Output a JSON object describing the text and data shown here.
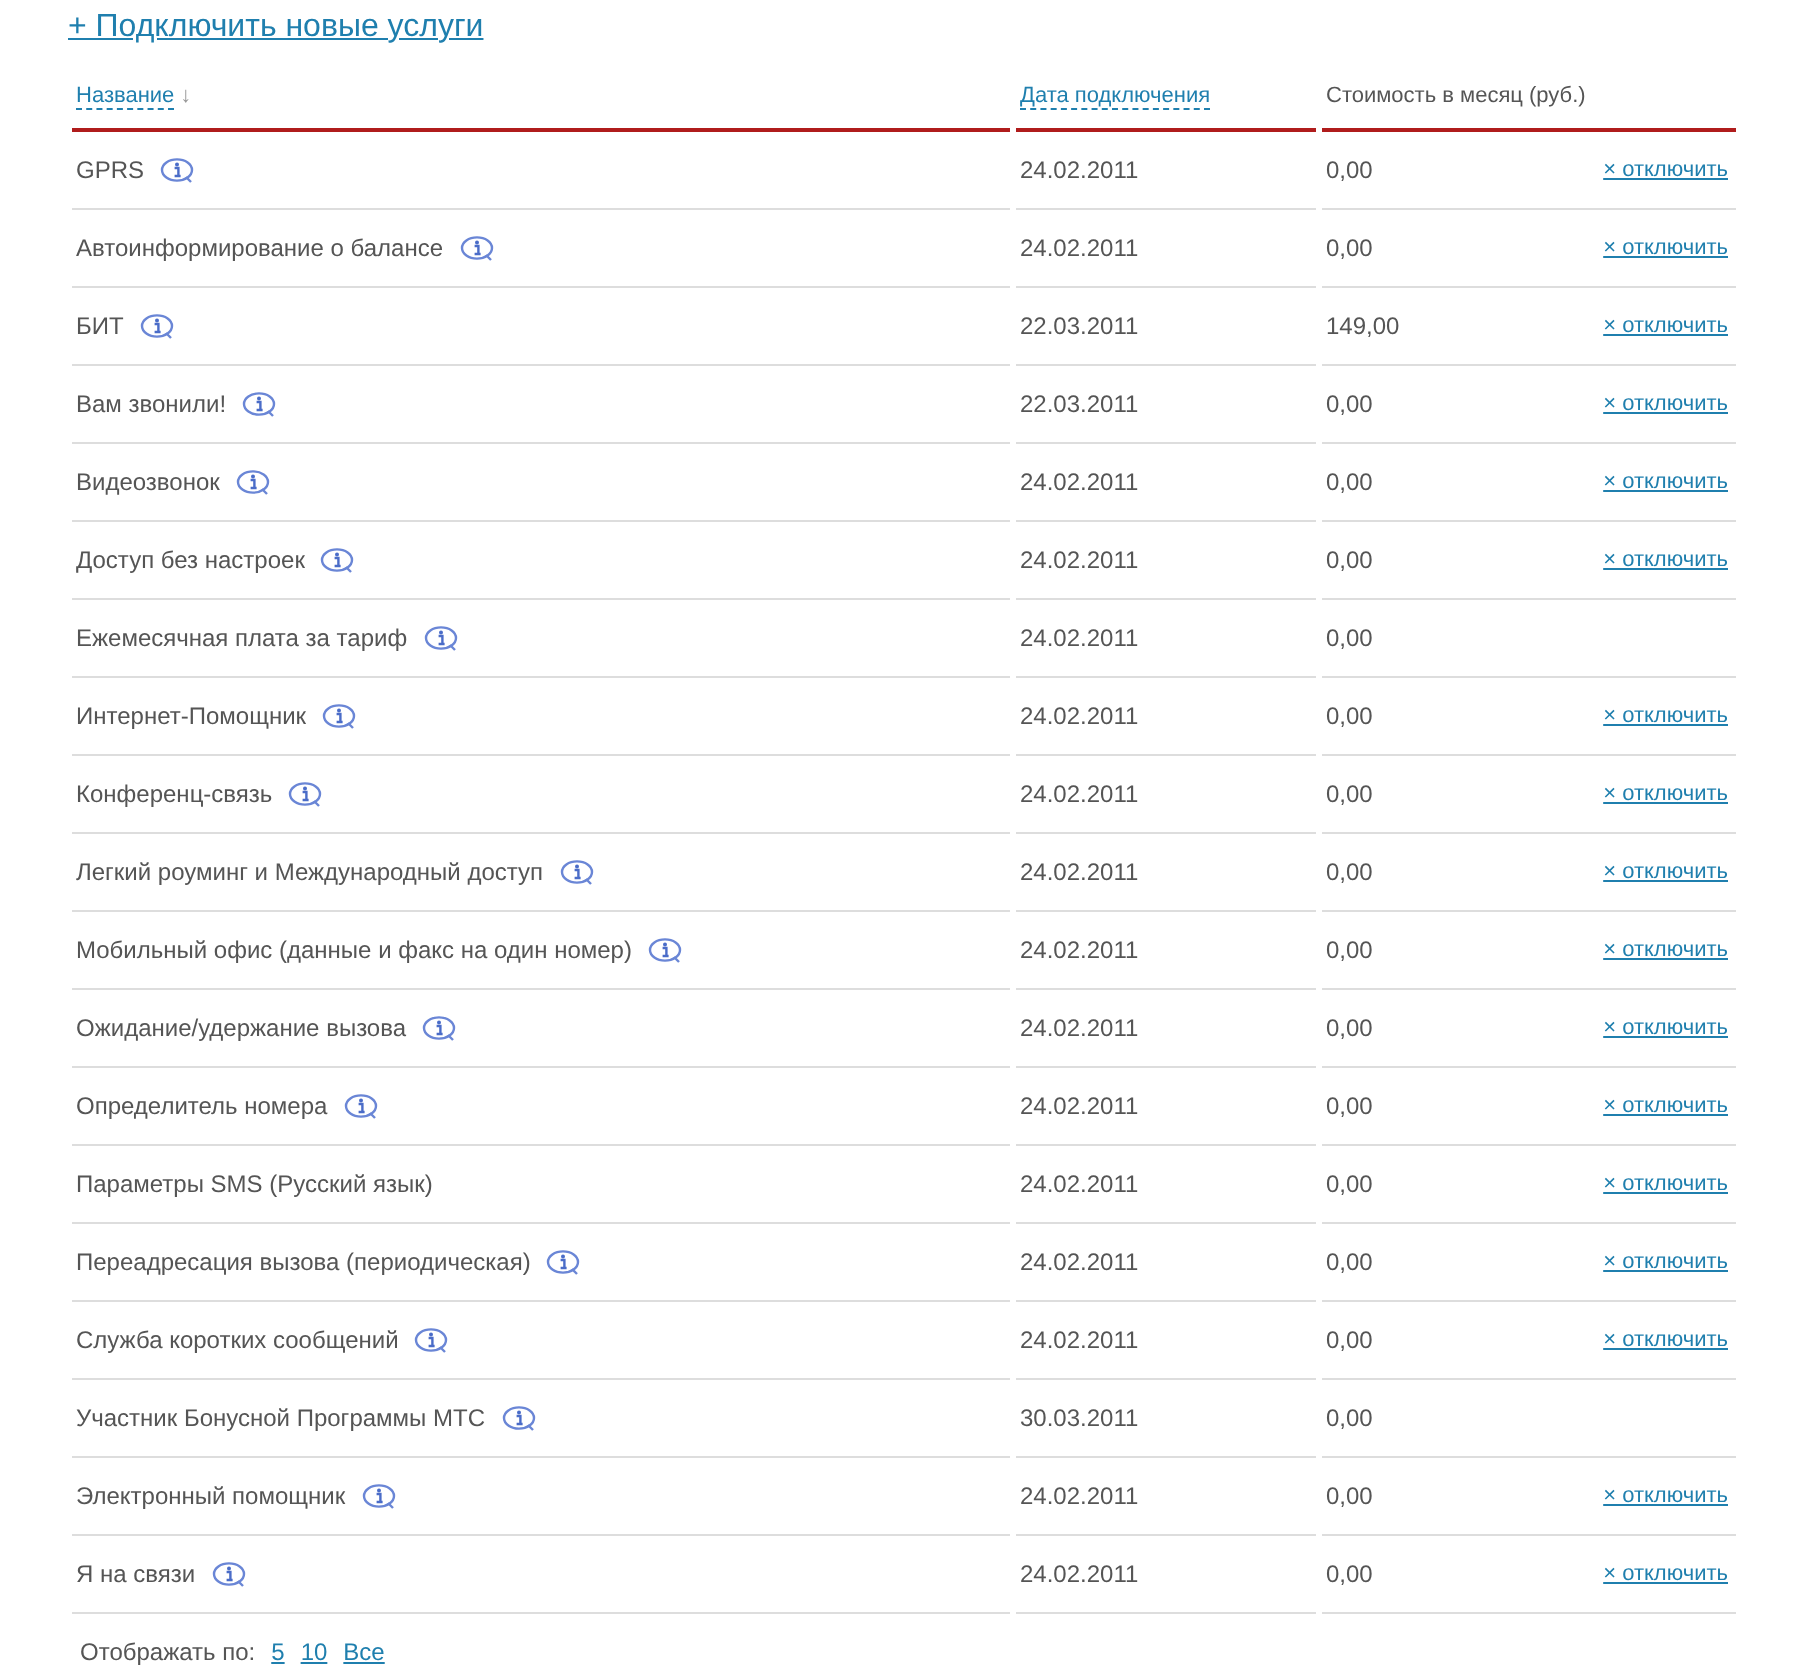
{
  "add_link": "+ Подключить новые услуги",
  "columns": [
    {
      "label": "Название",
      "sortable": true,
      "sort_indicator": "↓"
    },
    {
      "label": "Дата подключения",
      "sortable": true
    },
    {
      "label": "Стоимость в месяц (руб.)",
      "sortable": false
    }
  ],
  "rows": [
    {
      "name": "GPRS",
      "info": true,
      "date": "24.02.2011",
      "cost": "0,00",
      "action": "× отключить"
    },
    {
      "name": "Автоинформирование о балансе",
      "info": true,
      "date": "24.02.2011",
      "cost": "0,00",
      "action": "× отключить"
    },
    {
      "name": "БИТ",
      "info": true,
      "date": "22.03.2011",
      "cost": "149,00",
      "action": "× отключить"
    },
    {
      "name": "Вам звонили!",
      "info": true,
      "date": "22.03.2011",
      "cost": "0,00",
      "action": "× отключить"
    },
    {
      "name": "Видеозвонок",
      "info": true,
      "date": "24.02.2011",
      "cost": "0,00",
      "action": "× отключить"
    },
    {
      "name": "Доступ без настроек",
      "info": true,
      "date": "24.02.2011",
      "cost": "0,00",
      "action": "× отключить"
    },
    {
      "name": "Ежемесячная плата за тариф",
      "info": true,
      "date": "24.02.2011",
      "cost": "0,00"
    },
    {
      "name": "Интернет-Помощник",
      "info": true,
      "date": "24.02.2011",
      "cost": "0,00",
      "action": "× отключить"
    },
    {
      "name": "Конференц-связь",
      "info": true,
      "date": "24.02.2011",
      "cost": "0,00",
      "action": "× отключить"
    },
    {
      "name": "Легкий роуминг и Международный доступ",
      "info": true,
      "date": "24.02.2011",
      "cost": "0,00",
      "action": "× отключить"
    },
    {
      "name": "Мобильный офис (данные и факс на один номер)",
      "info": true,
      "date": "24.02.2011",
      "cost": "0,00",
      "action": "× отключить"
    },
    {
      "name": "Ожидание/удержание вызова",
      "info": true,
      "date": "24.02.2011",
      "cost": "0,00",
      "action": "× отключить"
    },
    {
      "name": "Определитель номера",
      "info": true,
      "date": "24.02.2011",
      "cost": "0,00",
      "action": "× отключить"
    },
    {
      "name": "Параметры SMS (Русский язык)",
      "info": false,
      "date": "24.02.2011",
      "cost": "0,00",
      "action": "× отключить"
    },
    {
      "name": "Переадресация вызова (периодическая)",
      "info": true,
      "date": "24.02.2011",
      "cost": "0,00",
      "action": "× отключить"
    },
    {
      "name": "Служба коротких сообщений",
      "info": true,
      "date": "24.02.2011",
      "cost": "0,00",
      "action": "× отключить"
    },
    {
      "name": "Участник Бонусной Программы МТС",
      "info": true,
      "date": "30.03.2011",
      "cost": "0,00"
    },
    {
      "name": "Электронный помощник",
      "info": true,
      "date": "24.02.2011",
      "cost": "0,00",
      "action": "× отключить"
    },
    {
      "name": "Я на связи",
      "info": true,
      "date": "24.02.2011",
      "cost": "0,00",
      "action": "× отключить"
    }
  ],
  "pagination": {
    "label": "Отображать по:",
    "options": [
      "5",
      "10",
      "Все"
    ]
  }
}
